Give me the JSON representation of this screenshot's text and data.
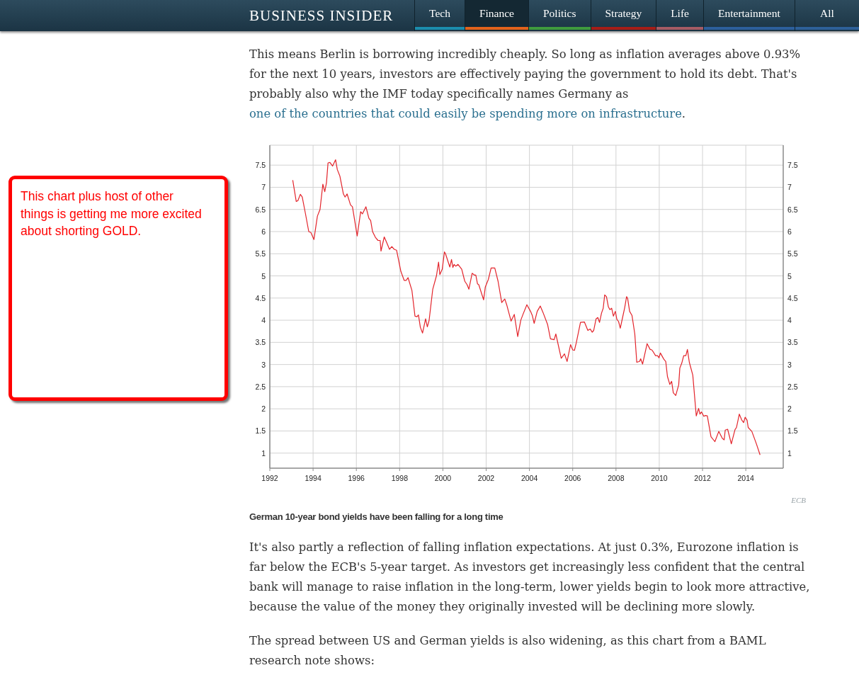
{
  "header": {
    "logo": "BUSINESS INSIDER",
    "tabs": [
      {
        "label": "Tech",
        "color": "#1b8dad",
        "selected": false
      },
      {
        "label": "Finance",
        "color": "#e2621b",
        "selected": true
      },
      {
        "label": "Politics",
        "color": "#3f9b3d",
        "selected": false
      },
      {
        "label": "Strategy",
        "color": "#a61d17",
        "selected": false
      },
      {
        "label": "Life",
        "color": "#a65b64",
        "selected": false
      },
      {
        "label": "Entertainment",
        "color": "#2c5f9c",
        "selected": false
      },
      {
        "label": "All",
        "color": "#2d6099",
        "selected": false
      }
    ]
  },
  "callout": {
    "text": "This chart plus host of other things is getting me more excited about shorting GOLD."
  },
  "article": {
    "blocks": [
      {
        "kind": "paragraph",
        "parts": [
          {
            "kind": "text",
            "text": "This means Berlin is borrowing incredibly cheaply. So long as inflation averages above 0.93% for the next 10 years, investors are effectively paying the government to hold its debt. That's probably also why the IMF today specifically names Germany as "
          },
          {
            "kind": "link",
            "text": "one of the countries that could easily be spending more on infrastructure"
          },
          {
            "kind": "text",
            "text": "."
          }
        ]
      },
      {
        "kind": "figure",
        "right_axis_labels": [
          "7.5",
          "7",
          "6.5",
          "6",
          "5.5",
          "5",
          "4.5",
          "4",
          "3.5",
          "3",
          "2.5",
          "2",
          "1.5",
          "1"
        ],
        "source": "ECB",
        "caption": "German 10-year bond yields have been falling for a long time",
        "chart_data": {
          "type": "line",
          "xlim": [
            1992,
            2015.73
          ],
          "ylim": [
            0.66,
            7.95
          ],
          "xticks": [
            1992,
            1994,
            1996,
            1998,
            2000,
            2002,
            2004,
            2006,
            2008,
            2010,
            2012,
            2014
          ],
          "yticks": [
            1,
            1.5,
            2,
            2.5,
            3,
            3.5,
            4,
            4.5,
            5,
            5.5,
            6,
            6.5,
            7,
            7.5
          ],
          "grid": true,
          "x": [
            1993.06,
            1993.22,
            1993.3,
            1993.41,
            1993.5,
            1993.65,
            1993.8,
            1993.9,
            1994.04,
            1994.2,
            1994.32,
            1994.45,
            1994.54,
            1994.62,
            1994.69,
            1994.78,
            1994.9,
            1995.04,
            1995.12,
            1995.24,
            1995.4,
            1995.48,
            1995.57,
            1995.73,
            1995.82,
            1996.04,
            1996.2,
            1996.28,
            1996.44,
            1996.58,
            1996.66,
            1996.75,
            1996.88,
            1997.0,
            1997.1,
            1997.14,
            1997.29,
            1997.43,
            1997.53,
            1997.64,
            1997.75,
            1997.86,
            1998.06,
            1998.21,
            1998.3,
            1998.39,
            1998.57,
            1998.71,
            1998.8,
            1998.87,
            1998.96,
            1999.06,
            1999.2,
            1999.28,
            1999.36,
            1999.53,
            1999.7,
            1999.8,
            1999.86,
            1999.97,
            2000.07,
            2000.12,
            2000.32,
            2000.4,
            2000.46,
            2000.52,
            2000.6,
            2000.7,
            2000.87,
            2001.01,
            2001.12,
            2001.2,
            2001.35,
            2001.45,
            2001.52,
            2001.6,
            2001.66,
            2001.88,
            2001.96,
            2002.1,
            2002.23,
            2002.4,
            2002.55,
            2002.72,
            2002.86,
            2002.95,
            2003.15,
            2003.3,
            2003.46,
            2003.6,
            2003.7,
            2003.88,
            2004.05,
            2004.13,
            2004.22,
            2004.36,
            2004.5,
            2004.63,
            2004.84,
            2004.97,
            2005.14,
            2005.22,
            2005.47,
            2005.62,
            2005.74,
            2005.9,
            2006.0,
            2006.08,
            2006.17,
            2006.36,
            2006.54,
            2006.7,
            2006.81,
            2006.9,
            2006.97,
            2007.08,
            2007.16,
            2007.24,
            2007.33,
            2007.41,
            2007.48,
            2007.56,
            2007.65,
            2007.72,
            2007.8,
            2007.88,
            2007.97,
            2008.04,
            2008.12,
            2008.2,
            2008.3,
            2008.4,
            2008.49,
            2008.54,
            2008.63,
            2008.74,
            2008.87,
            2008.96,
            2009.09,
            2009.14,
            2009.23,
            2009.44,
            2009.58,
            2009.66,
            2009.74,
            2009.83,
            2009.92,
            2009.99,
            2010.05,
            2010.21,
            2010.3,
            2010.38,
            2010.49,
            2010.57,
            2010.65,
            2010.76,
            2010.9,
            2010.95,
            2011.04,
            2011.13,
            2011.23,
            2011.3,
            2011.39,
            2011.55,
            2011.71,
            2011.82,
            2011.88,
            2011.95,
            2012.06,
            2012.13,
            2012.22,
            2012.39,
            2012.57,
            2012.75,
            2012.92,
            2013.0,
            2013.05,
            2013.16,
            2013.33,
            2013.5,
            2013.57,
            2013.7,
            2013.81,
            2013.9,
            2013.97,
            2014.06,
            2014.11,
            2014.28,
            2014.49,
            2014.66
          ],
          "series": [
            {
              "color": "#e3242b",
              "values": [
                7.16,
                6.68,
                6.7,
                6.84,
                6.78,
                6.4,
                6.0,
                5.98,
                5.82,
                6.35,
                6.5,
                7.07,
                6.9,
                7.1,
                7.55,
                7.56,
                7.48,
                7.62,
                7.4,
                7.25,
                6.85,
                6.78,
                6.85,
                6.6,
                6.56,
                5.9,
                6.45,
                6.4,
                6.56,
                6.3,
                6.25,
                6.0,
                5.87,
                5.8,
                5.8,
                5.56,
                5.88,
                5.72,
                5.6,
                5.66,
                5.6,
                5.58,
                5.1,
                4.9,
                4.9,
                4.96,
                4.67,
                4.09,
                4.08,
                4.12,
                3.84,
                3.71,
                4.03,
                3.85,
                3.99,
                4.7,
                5.0,
                5.31,
                5.03,
                5.15,
                5.54,
                5.5,
                5.2,
                5.37,
                5.19,
                5.26,
                5.22,
                5.26,
                5.15,
                4.88,
                4.8,
                4.7,
                5.06,
                5.02,
                5.02,
                4.82,
                4.8,
                4.46,
                4.75,
                4.92,
                5.18,
                5.18,
                4.88,
                4.4,
                4.48,
                4.35,
                3.98,
                4.13,
                3.63,
                4.0,
                4.13,
                4.35,
                4.2,
                4.11,
                3.93,
                4.2,
                4.32,
                4.17,
                3.9,
                3.58,
                3.56,
                3.69,
                3.14,
                3.24,
                3.07,
                3.45,
                3.33,
                3.32,
                3.5,
                3.95,
                3.96,
                3.77,
                3.8,
                3.73,
                3.77,
                4.03,
                4.06,
                3.95,
                4.16,
                4.27,
                4.57,
                4.53,
                4.3,
                4.24,
                4.27,
                4.09,
                4.2,
                4.02,
                3.97,
                3.82,
                4.05,
                4.28,
                4.53,
                4.49,
                4.2,
                4.11,
                3.69,
                3.05,
                3.07,
                3.13,
                3.01,
                3.47,
                3.34,
                3.33,
                3.27,
                3.2,
                3.2,
                3.15,
                3.26,
                3.12,
                3.07,
                2.73,
                2.55,
                2.62,
                2.36,
                2.3,
                2.54,
                2.92,
                3.03,
                3.2,
                3.2,
                3.34,
                3.05,
                2.76,
                1.84,
                2.01,
                1.88,
                1.93,
                1.83,
                1.85,
                1.84,
                1.37,
                1.26,
                1.49,
                1.33,
                1.3,
                1.52,
                1.54,
                1.21,
                1.53,
                1.58,
                1.88,
                1.75,
                1.69,
                1.81,
                1.74,
                1.58,
                1.49,
                1.21,
                0.96
              ]
            }
          ]
        }
      },
      {
        "kind": "paragraph",
        "parts": [
          {
            "kind": "text",
            "text": "It's also partly a reflection of falling inflation expectations. At just 0.3%, Eurozone inflation is far below the ECB's 5-year target. As investors get increasingly less confident that the central bank will manage to raise inflation in the long-term, lower yields begin to look more attractive, because the value of the money they originally invested will be declining more slowly."
          }
        ]
      },
      {
        "kind": "paragraph",
        "parts": [
          {
            "kind": "text",
            "text": "The spread between US and German yields is also widening, as this chart from a BAML research note shows:"
          }
        ]
      }
    ]
  }
}
